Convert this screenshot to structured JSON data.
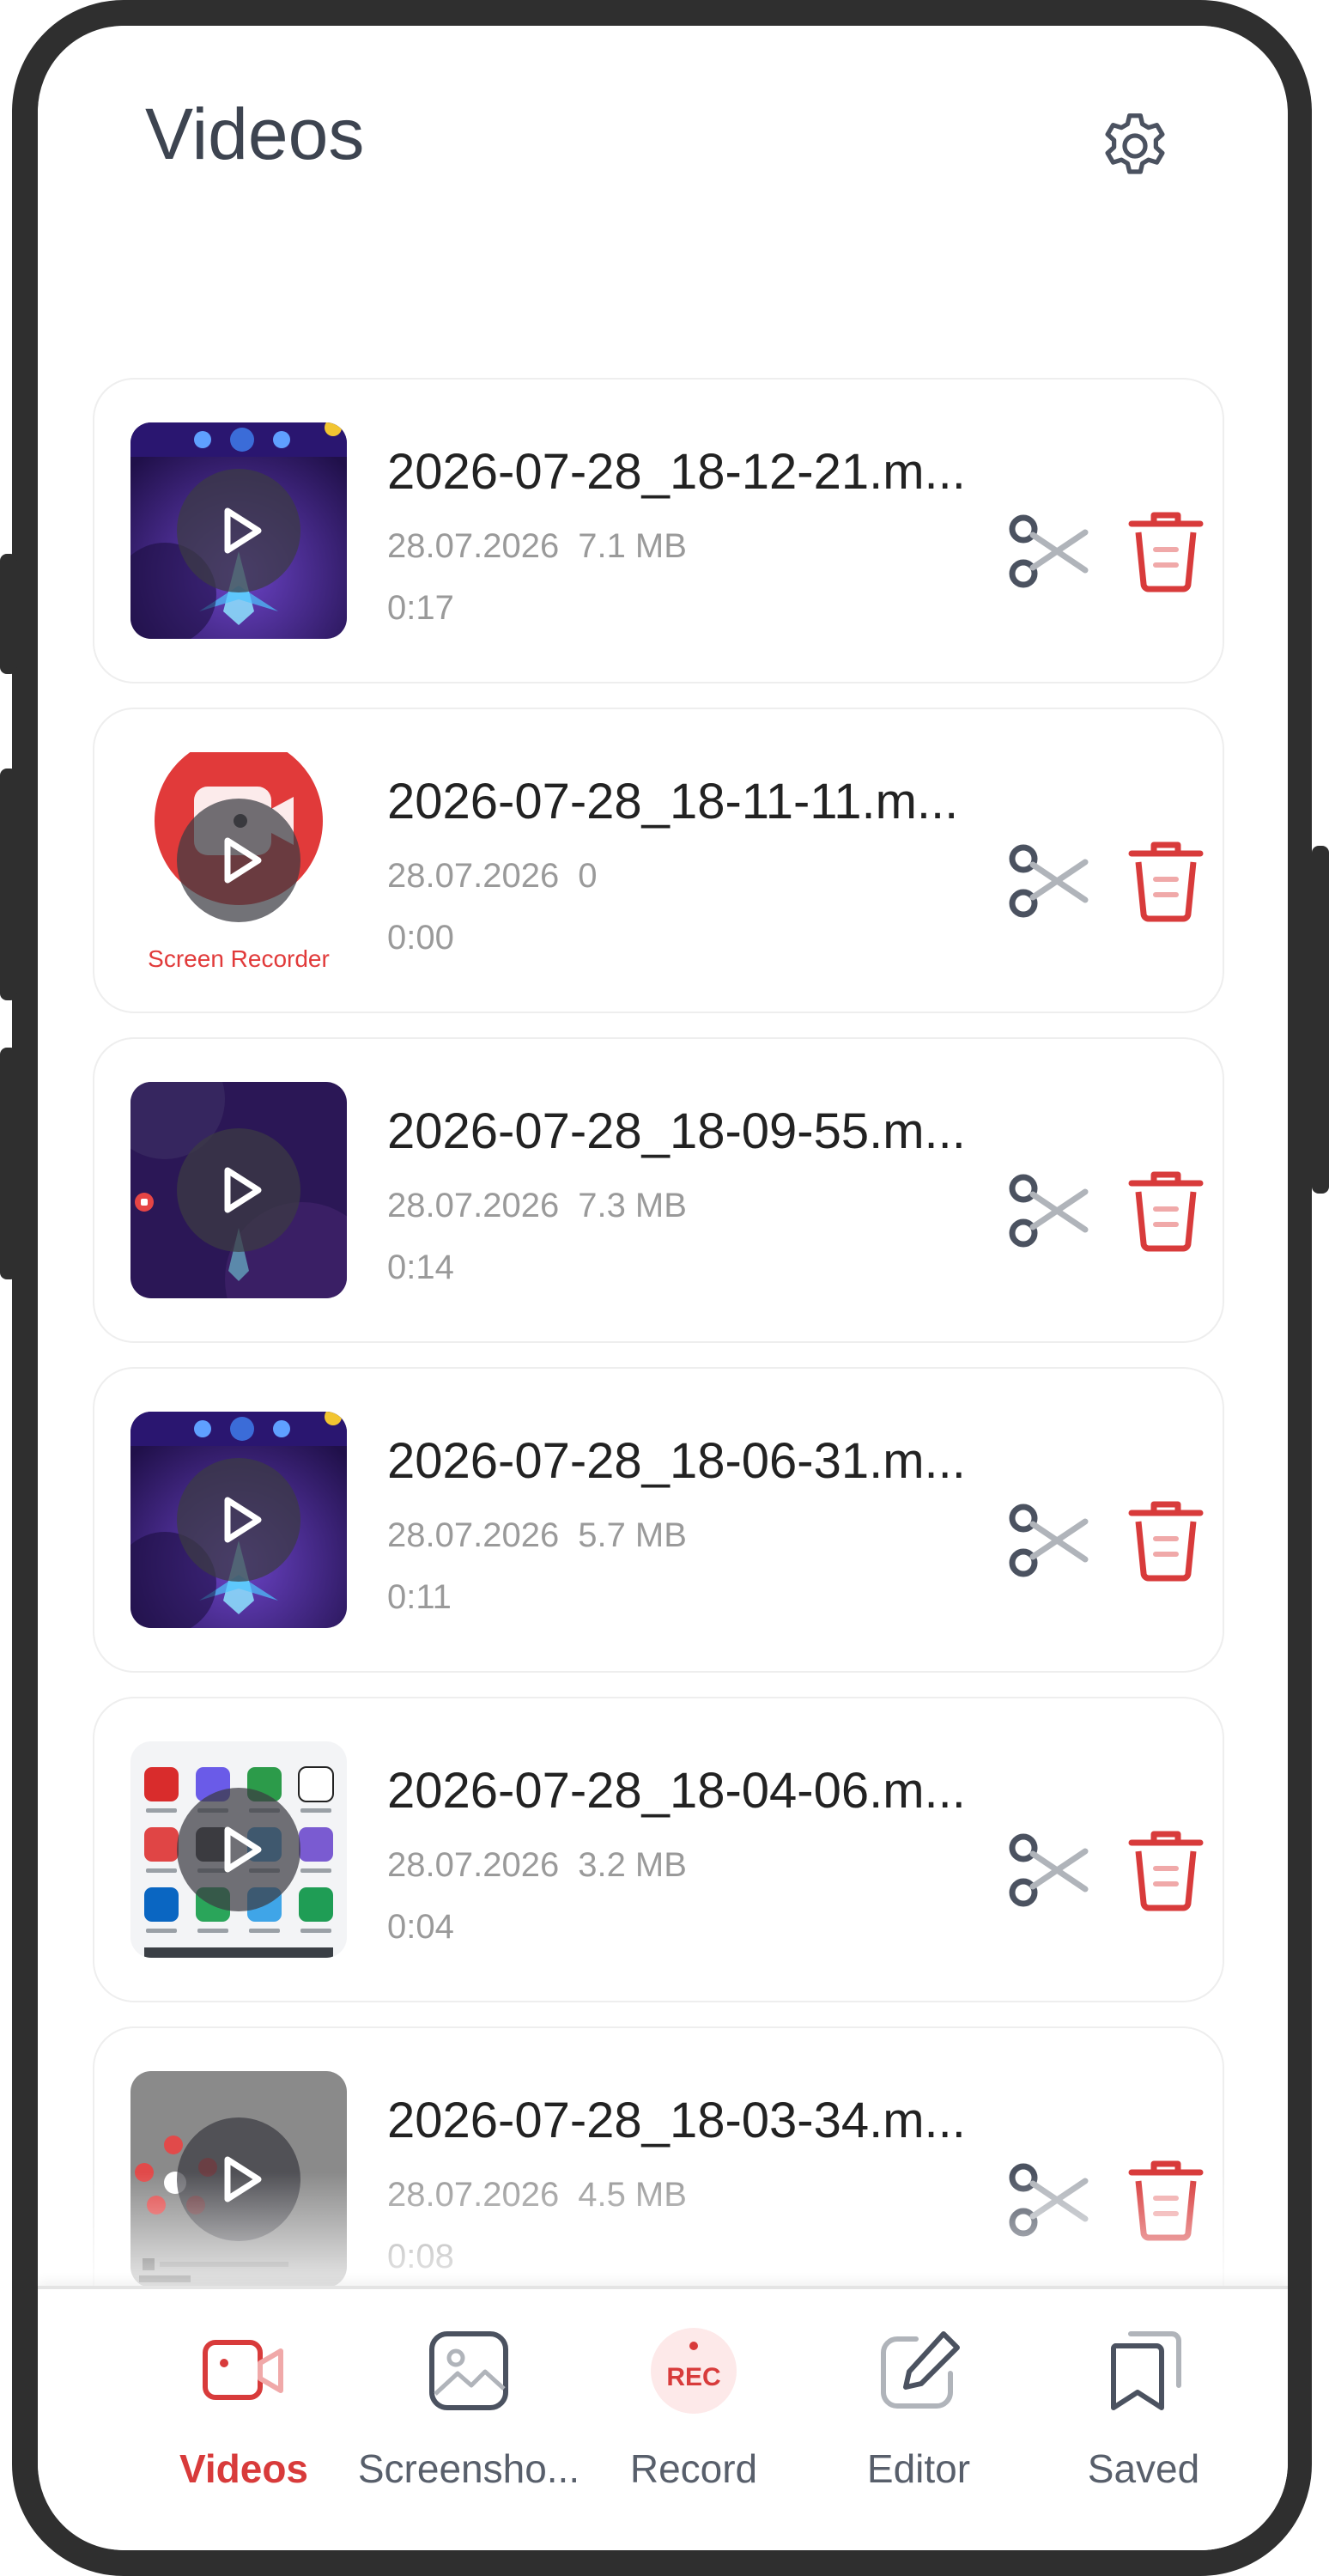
{
  "header": {
    "title": "Videos"
  },
  "videos": [
    {
      "title": "2026-07-28_18-12-21.m...",
      "date": "28.07.2026",
      "size": "7.1 MB",
      "duration": "0:17",
      "thumb": "game-space-shooter"
    },
    {
      "title": "2026-07-28_18-11-11.m...",
      "date": "28.07.2026",
      "size": "0",
      "duration": "0:00",
      "thumb": "screen-recorder-logo",
      "thumb_caption": "Screen Recorder"
    },
    {
      "title": "2026-07-28_18-09-55.m...",
      "date": "28.07.2026",
      "size": "7.3 MB",
      "duration": "0:14",
      "thumb": "game-space-dark"
    },
    {
      "title": "2026-07-28_18-06-31.m...",
      "date": "28.07.2026",
      "size": "5.7 MB",
      "duration": "0:11",
      "thumb": "game-space-shooter"
    },
    {
      "title": "2026-07-28_18-04-06.m...",
      "date": "28.07.2026",
      "size": "3.2 MB",
      "duration": "0:04",
      "thumb": "home-screen-apps"
    },
    {
      "title": "2026-07-28_18-03-34.m...",
      "date": "28.07.2026",
      "size": "4.5 MB",
      "duration": "0:08",
      "thumb": "recorder-overlay-menu"
    }
  ],
  "tabs": [
    {
      "label": "Videos",
      "icon": "video-camera-icon",
      "active": true
    },
    {
      "label": "Screensho...",
      "icon": "image-icon",
      "active": false
    },
    {
      "label": "Record",
      "icon": "rec-icon",
      "icon_text": "REC",
      "active": false
    },
    {
      "label": "Editor",
      "icon": "pencil-edit-icon",
      "active": false
    },
    {
      "label": "Saved",
      "icon": "bookmark-icon",
      "active": false
    }
  ],
  "colors": {
    "accent": "#d83b3b",
    "icon_gray": "#4b5260",
    "text_gray": "#9a9a9a"
  }
}
